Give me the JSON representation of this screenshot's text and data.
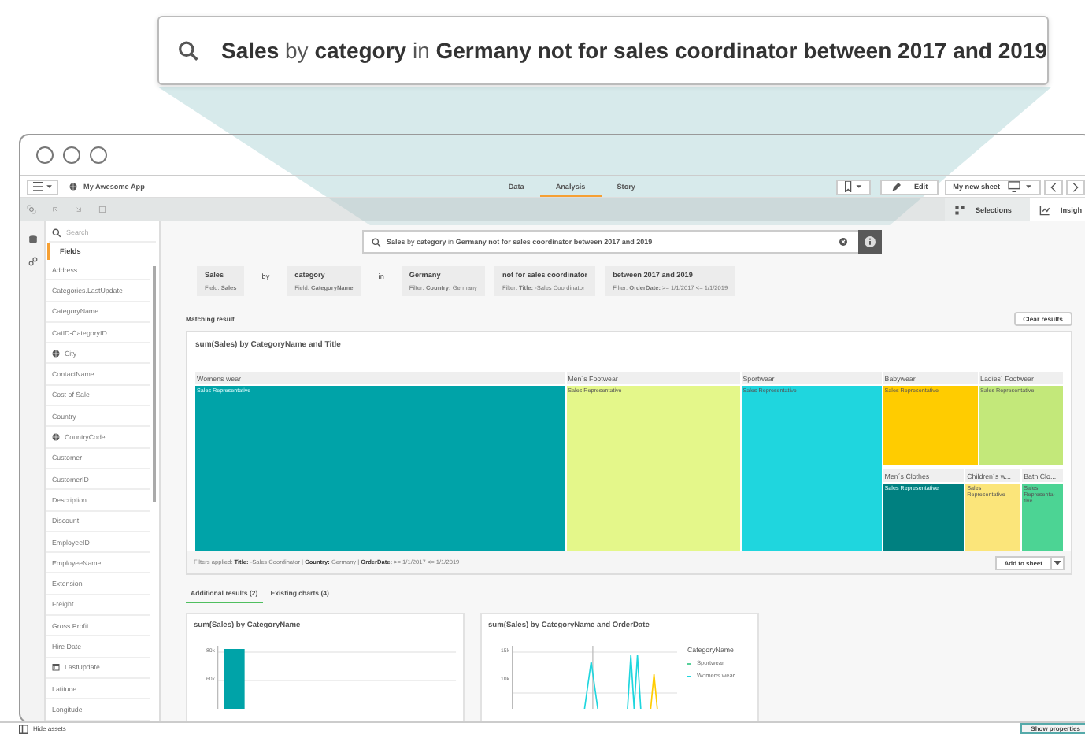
{
  "callout": {
    "query": "**Sales** by **category** in **Germany not for sales coordinator between 2017 and 2019**"
  },
  "window": {
    "app_name": "My Awesome App"
  },
  "tabs": [
    {
      "label": "Data",
      "selected": false
    },
    {
      "label": "Analysis",
      "selected": true
    },
    {
      "label": "Story",
      "selected": false
    }
  ],
  "toolbar": {
    "edit": "Edit",
    "sheet": "My new sheet"
  },
  "panel_tabs": [
    {
      "label": "Selections",
      "selected": false
    },
    {
      "label": "Insigh",
      "selected": true
    }
  ],
  "sidebar": {
    "search_placeholder": "Search",
    "heading": "Fields",
    "fields": [
      {
        "label": "Address",
        "kind": "text"
      },
      {
        "label": "Categories.LastUpdate",
        "kind": "text"
      },
      {
        "label": "CategoryName",
        "kind": "text"
      },
      {
        "label": "CatID-CategoryID",
        "kind": "text"
      },
      {
        "label": "City",
        "kind": "geo"
      },
      {
        "label": "ContactName",
        "kind": "text"
      },
      {
        "label": "Cost of Sale",
        "kind": "text"
      },
      {
        "label": "Country",
        "kind": "text"
      },
      {
        "label": "CountryCode",
        "kind": "geo"
      },
      {
        "label": "Customer",
        "kind": "text"
      },
      {
        "label": "CustomerID",
        "kind": "text"
      },
      {
        "label": "Description",
        "kind": "text"
      },
      {
        "label": "Discount",
        "kind": "text"
      },
      {
        "label": "EmployeeID",
        "kind": "text"
      },
      {
        "label": "EmployeeName",
        "kind": "text"
      },
      {
        "label": "Extension",
        "kind": "text"
      },
      {
        "label": "Freight",
        "kind": "text"
      },
      {
        "label": "Gross Profit",
        "kind": "text"
      },
      {
        "label": "Hire Date",
        "kind": "text"
      },
      {
        "label": "LastUpdate",
        "kind": "date"
      },
      {
        "label": "Latitude",
        "kind": "text"
      },
      {
        "label": "Longitude",
        "kind": "text"
      }
    ]
  },
  "search": {
    "query": "**Sales** by **category** in **Germany not for sales coordinator between 2017 and 2019**"
  },
  "tokens": [
    {
      "kind": "chip",
      "label": "Sales",
      "detail": "Field: **Sales**"
    },
    {
      "kind": "word",
      "label": "by"
    },
    {
      "kind": "chip",
      "label": "category",
      "detail": "Field: **CategoryName**"
    },
    {
      "kind": "word",
      "label": "in"
    },
    {
      "kind": "chip",
      "label": "Germany",
      "detail": "Filter: **Country:** Germany"
    },
    {
      "kind": "chip",
      "label": "not for sales coordinator",
      "detail": "Filter: **Title:** -Sales Coordinator"
    },
    {
      "kind": "chip",
      "label": "between 2017 and 2019",
      "detail": "Filter: **OrderDate:** >= 1/1/2017 <= 1/1/2019"
    }
  ],
  "result": {
    "heading": "Matching result",
    "clear": "Clear results",
    "chart_title": "sum(Sales) by CategoryName and Title",
    "tiles": [
      {
        "label": "Womens wear",
        "sublabel": "Sales Representative",
        "color": "#00a3a8"
      },
      {
        "label": "Men´s Footwear",
        "sublabel": "Sales Representative",
        "color": "#e4f78a"
      },
      {
        "label": "Sportwear",
        "sublabel": "Sales Representative",
        "color": "#1fd6de"
      },
      {
        "label": "Babywear",
        "sublabel": "Sales Representative",
        "color": "#ffcc00"
      },
      {
        "label": "Ladies´ Footwear",
        "sublabel": "Sales Representative",
        "color": "#c3e87a"
      },
      {
        "label": "Men´s Clothes",
        "sublabel": "Sales Representative",
        "color": "#008080"
      },
      {
        "label": "Children´s w...",
        "sublabel": "Sales Representative",
        "color": "#fbe57a"
      },
      {
        "label": "Bath Clo...",
        "sublabel": "Sales Representa-tive",
        "color": "#4cd494"
      }
    ],
    "filters": "Filters applied: **Title:** -Sales Coordinator | **Country:** Germany | **OrderDate:** >= 1/1/2017 <= 1/1/2019",
    "add": "Add to sheet"
  },
  "result_tabs": [
    {
      "label": "Additional results (2)",
      "selected": true
    },
    {
      "label": "Existing charts (4)",
      "selected": false
    }
  ],
  "cards": [
    {
      "kind": "bar",
      "title": "sum(Sales) by CategoryName",
      "tick_labels": [
        "80k",
        "60k"
      ]
    },
    {
      "kind": "line",
      "title": "sum(Sales) by CategoryName and OrderDate",
      "tick_labels": [
        "15k",
        "10k"
      ],
      "legend_title": "CategoryName",
      "legend": [
        {
          "label": "Sportwear",
          "color": "#57d09a"
        },
        {
          "label": "Womens wear",
          "color": "#1fd6de"
        }
      ]
    }
  ],
  "footer": {
    "hide": "Hide assets",
    "show": "Show properties"
  }
}
